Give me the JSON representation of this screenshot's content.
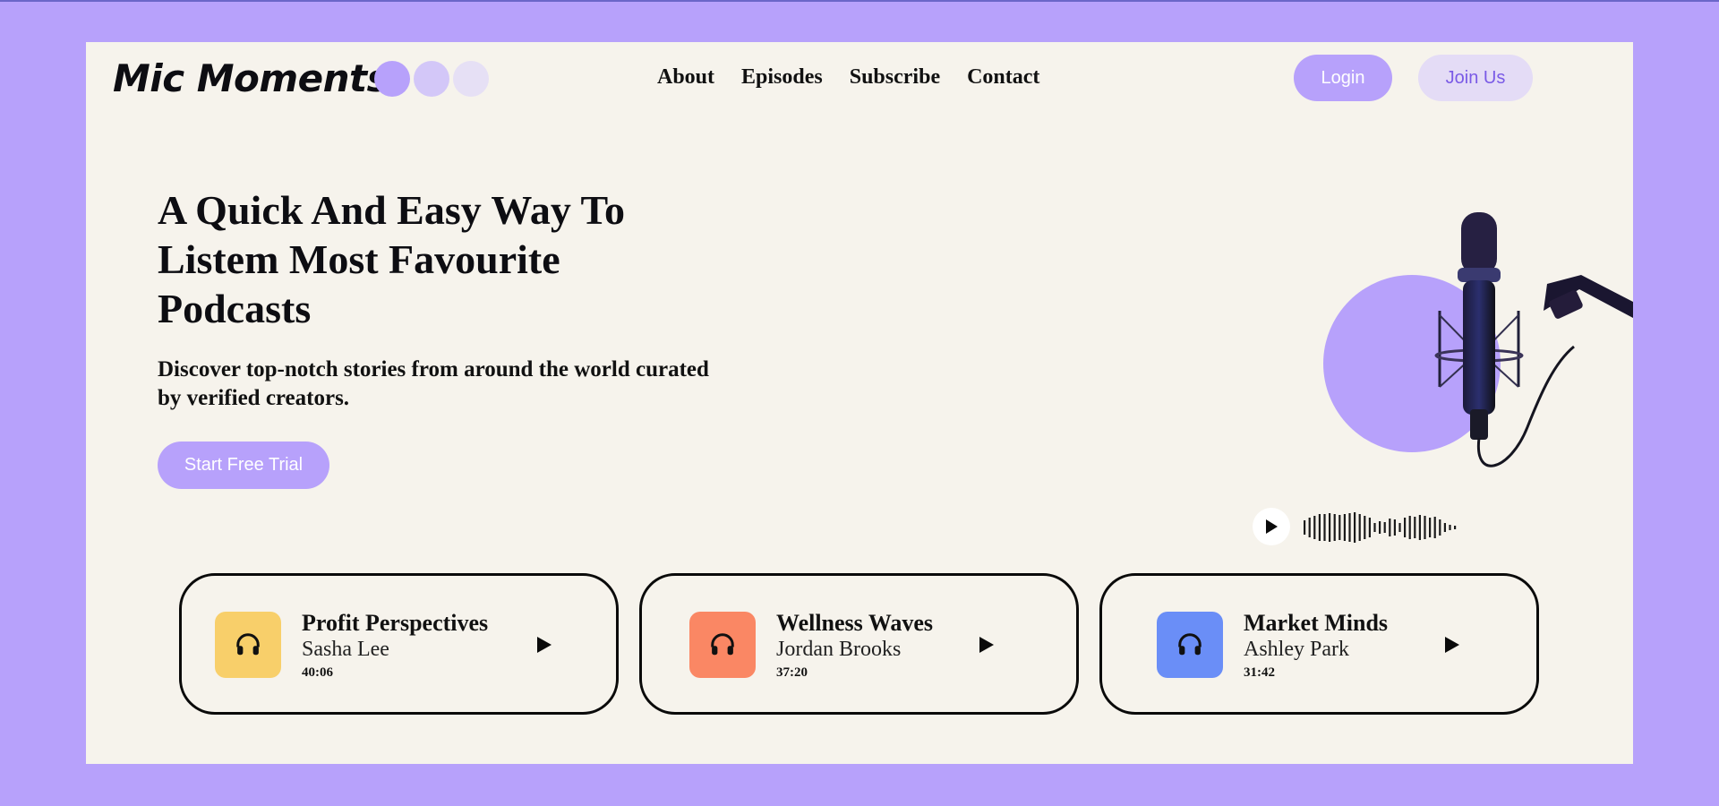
{
  "brand": {
    "name": "Mic Moments"
  },
  "nav": {
    "items": [
      "About",
      "Episodes",
      "Subscribe",
      "Contact"
    ]
  },
  "header": {
    "login_label": "Login",
    "join_label": "Join Us"
  },
  "hero": {
    "title": "A Quick And Easy Way To Listem Most Favourite Podcasts",
    "subtitle": "Discover top-notch stories from around the world curated by verified creators.",
    "cta_label": "Start Free Trial"
  },
  "colors": {
    "accent": "#b7a1fb",
    "background": "#f6f3ec",
    "card_yellow": "#f8cf6a",
    "card_orange": "#fa8764",
    "card_blue": "#6a8ef7"
  },
  "episodes": [
    {
      "title": "Profit Perspectives",
      "author": "Sasha Lee",
      "duration": "40:06",
      "icon": "headphones-icon",
      "color": "#f8cf6a"
    },
    {
      "title": "Wellness Waves",
      "author": "Jordan Brooks",
      "duration": "37:20",
      "icon": "headphones-icon",
      "color": "#fa8764"
    },
    {
      "title": "Market Minds",
      "author": "Ashley Park",
      "duration": "31:42",
      "icon": "headphones-icon",
      "color": "#6a8ef7"
    }
  ]
}
